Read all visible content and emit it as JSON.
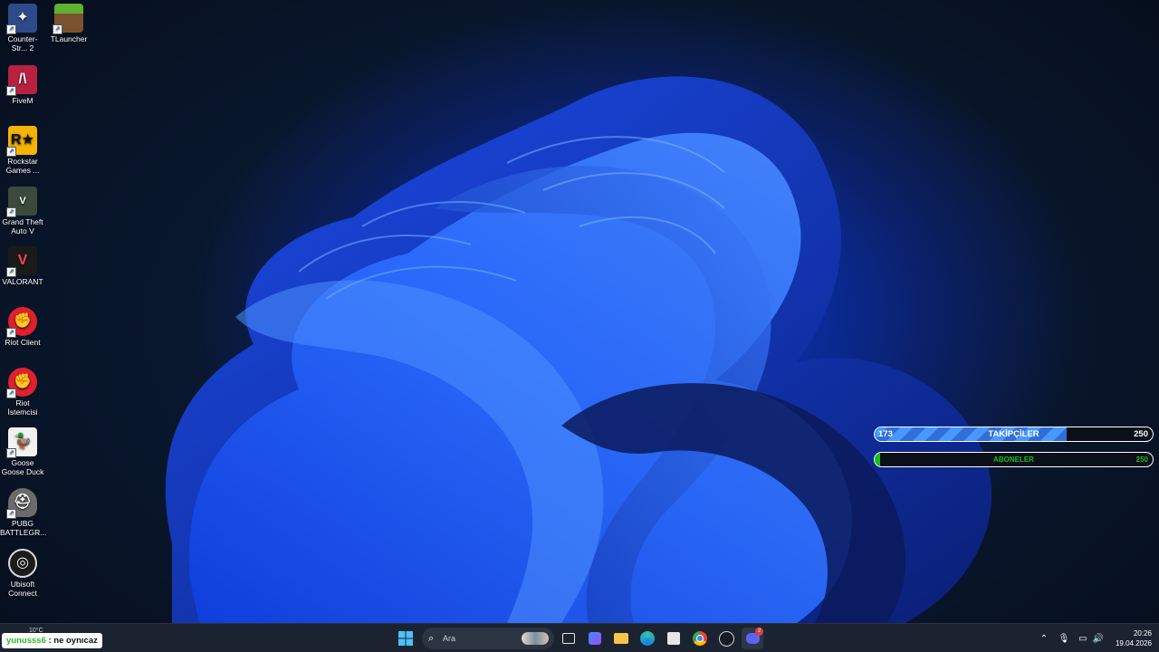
{
  "desktop": {
    "icons": [
      {
        "label": "Counter-Str... 2",
        "icon": "counter-strike-icon",
        "color": "#2d4a8a"
      },
      {
        "label": "TLauncher",
        "icon": "tlauncher-grass-block-icon",
        "color": "#5a8c2a"
      },
      {
        "label": "FiveM",
        "icon": "fivem-icon",
        "color": "#b8213f"
      },
      {
        "label": "Rockstar Games ...",
        "icon": "rockstar-icon",
        "color": "#f6b400"
      },
      {
        "label": "Grand Theft Auto V",
        "icon": "gta-v-icon",
        "color": "#3b4a3a"
      },
      {
        "label": "VALORANT",
        "icon": "valorant-icon",
        "color": "#fd4556"
      },
      {
        "label": "Riot Client",
        "icon": "riot-fist-icon",
        "color": "#e0202c"
      },
      {
        "label": "Riot İstemcisi",
        "icon": "riot-fist-icon",
        "color": "#e0202c"
      },
      {
        "label": "Goose Goose Duck",
        "icon": "goose-icon",
        "color": "#f2f2f2"
      },
      {
        "label": "PUBG BATTLEGR...",
        "icon": "pubg-helmet-icon",
        "color": "#6b6b6b"
      },
      {
        "label": "Ubisoft Connect",
        "icon": "ubisoft-swirl-icon",
        "color": "#1c1c1c"
      }
    ]
  },
  "widgets": {
    "followers": {
      "current": "173",
      "label": "TAKİPÇİLER",
      "goal": "250",
      "progress": 0.69,
      "accent": "#3e8bf5"
    },
    "subscribers": {
      "label": "ABONELER",
      "goal": "250",
      "progress": 0.02,
      "accent": "#17c017"
    }
  },
  "chat": {
    "username": "yunusss6",
    "separator": ":",
    "message": "ne oynıcaz"
  },
  "weather": {
    "temp": "10°C"
  },
  "taskbar": {
    "search_placeholder": "Ara",
    "apps": [
      "windows-start-icon",
      "task-view-icon",
      "widgets-icon",
      "file-explorer-icon",
      "edge-icon",
      "microsoft-store-icon",
      "chrome-icon",
      "steam-icon",
      "discord-icon"
    ],
    "discord_badge": "2",
    "time": "20:26",
    "date": "19.04.2026"
  }
}
